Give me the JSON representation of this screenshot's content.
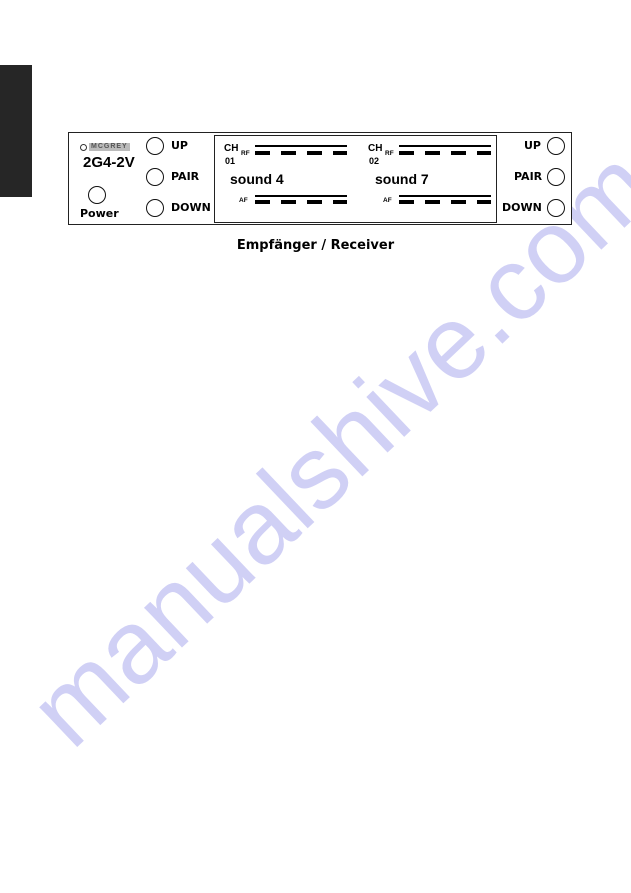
{
  "page": {
    "side_tab_color": "#262626",
    "watermark": "manualshive.com",
    "watermark_color": "#c8c8f4"
  },
  "device": {
    "brand_logo": "MCGREY",
    "model": "2G4-2V",
    "power_label": "Power",
    "left_buttons": [
      {
        "label": "UP"
      },
      {
        "label": "PAIR"
      },
      {
        "label": "DOWN"
      }
    ],
    "right_buttons": [
      {
        "label": "UP"
      },
      {
        "label": "PAIR"
      },
      {
        "label": "DOWN"
      }
    ],
    "display": {
      "channels": [
        {
          "ch_label": "CH",
          "ch_number": "01",
          "rf_label": "RF",
          "af_label": "AF",
          "sound": "sound 4",
          "rf_segments": 4,
          "af_segments": 4
        },
        {
          "ch_label": "CH",
          "ch_number": "02",
          "rf_label": "RF",
          "af_label": "AF",
          "sound": "sound 7",
          "rf_segments": 4,
          "af_segments": 4
        }
      ]
    }
  },
  "caption": "Empfänger / Receiver"
}
